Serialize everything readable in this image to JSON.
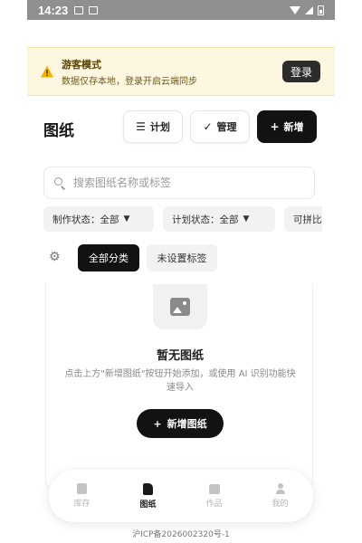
{
  "status_bar": {
    "time": "14:23"
  },
  "banner": {
    "title": "游客模式",
    "subtitle": "数据仅存本地，登录开启云端同步",
    "login_label": "登录"
  },
  "header": {
    "title": "图纸",
    "plan_label": "计划",
    "manage_label": "管理",
    "add_label": "新增"
  },
  "search": {
    "placeholder": "搜索图纸名称或标签",
    "value": ""
  },
  "filters": [
    {
      "label": "制作状态：全部"
    },
    {
      "label": "计划状态：全部"
    },
    {
      "label": "可拼比"
    }
  ],
  "categories": [
    {
      "label": "全部分类",
      "active": true
    },
    {
      "label": "未设置标签",
      "active": false
    }
  ],
  "empty_state": {
    "title": "暂无图纸",
    "description": "点击上方\"新增图纸\"按钮开始添加，或使用 AI 识别功能快速导入",
    "add_label": "新增图纸"
  },
  "nav": [
    {
      "label": "库存",
      "icon": "box-icon"
    },
    {
      "label": "图纸",
      "icon": "drawing-icon",
      "active": true
    },
    {
      "label": "作品",
      "icon": "image-icon"
    },
    {
      "label": "我的",
      "icon": "user-icon"
    }
  ],
  "footer": {
    "text": "沪ICP备2026002320号-1"
  },
  "colors": {
    "accent": "#121212",
    "banner_bg": "#fdf6e0",
    "warning": "#f0b400"
  }
}
